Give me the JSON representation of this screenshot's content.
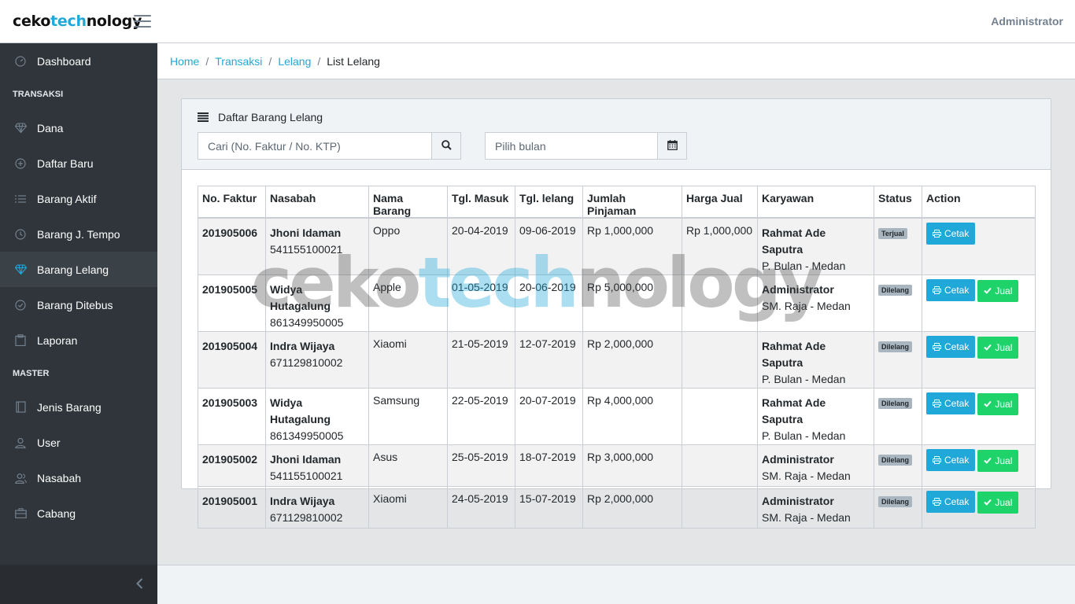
{
  "brand": {
    "part1": "ceko",
    "part2": "tech",
    "part3": "nology"
  },
  "header": {
    "user": "Administrator"
  },
  "sidebar": {
    "items": [
      {
        "label": "Dashboard",
        "icon": "speedometer-icon"
      },
      {
        "section": "TRANSAKSI"
      },
      {
        "label": "Dana",
        "icon": "diamond-icon"
      },
      {
        "label": "Daftar Baru",
        "icon": "plus-circle-icon"
      },
      {
        "label": "Barang Aktif",
        "icon": "list-icon"
      },
      {
        "label": "Barang J. Tempo",
        "icon": "clock-icon"
      },
      {
        "label": "Barang Lelang",
        "icon": "diamond-icon",
        "active": true
      },
      {
        "label": "Barang Ditebus",
        "icon": "check-circle-icon"
      },
      {
        "label": "Laporan",
        "icon": "clipboard-icon"
      },
      {
        "section": "MASTER"
      },
      {
        "label": "Jenis Barang",
        "icon": "book-icon"
      },
      {
        "label": "User",
        "icon": "user-icon"
      },
      {
        "label": "Nasabah",
        "icon": "users-icon"
      },
      {
        "label": "Cabang",
        "icon": "briefcase-icon"
      }
    ]
  },
  "breadcrumb": {
    "home": "Home",
    "transaksi": "Transaksi",
    "lelang": "Lelang",
    "current": "List Lelang",
    "sep": "/"
  },
  "card": {
    "title": "Daftar Barang Lelang",
    "search_placeholder": "Cari (No. Faktur / No. KTP)",
    "month_placeholder": "Pilih bulan"
  },
  "table": {
    "headers": [
      "No. Faktur",
      "Nasabah",
      "Nama Barang",
      "Tgl. Masuk",
      "Tgl. lelang",
      "Jumlah Pinjaman",
      "Harga Jual",
      "Karyawan",
      "Status",
      "Action"
    ],
    "rows": [
      {
        "faktur": "201905006",
        "nama": "Jhoni Idaman",
        "ktp": "541155100021",
        "barang": "Oppo",
        "masuk": "20-04-2019",
        "lelang": "09-06-2019",
        "pinjaman": "Rp 1,000,000",
        "harga": "Rp 1,000,000",
        "karyawan": "Rahmat Ade Saputra",
        "cabang": "P. Bulan - Medan",
        "status": "Terjual",
        "jual": false
      },
      {
        "faktur": "201905005",
        "nama": "Widya Hutagalung",
        "ktp": "861349950005",
        "barang": "Apple",
        "masuk": "01-05-2019",
        "lelang": "20-06-2019",
        "pinjaman": "Rp 5,000,000",
        "harga": "",
        "karyawan": "Administrator",
        "cabang": "SM. Raja - Medan",
        "status": "Dilelang",
        "jual": true
      },
      {
        "faktur": "201905004",
        "nama": "Indra Wijaya",
        "ktp": "671129810002",
        "barang": "Xiaomi",
        "masuk": "21-05-2019",
        "lelang": "12-07-2019",
        "pinjaman": "Rp 2,000,000",
        "harga": "",
        "karyawan": "Rahmat Ade Saputra",
        "cabang": "P. Bulan - Medan",
        "status": "Dilelang",
        "jual": true
      },
      {
        "faktur": "201905003",
        "nama": "Widya Hutagalung",
        "ktp": "861349950005",
        "barang": "Samsung",
        "masuk": "22-05-2019",
        "lelang": "20-07-2019",
        "pinjaman": "Rp 4,000,000",
        "harga": "",
        "karyawan": "Rahmat Ade Saputra",
        "cabang": "P. Bulan - Medan",
        "status": "Dilelang",
        "jual": true
      },
      {
        "faktur": "201905002",
        "nama": "Jhoni Idaman",
        "ktp": "541155100021",
        "barang": "Asus",
        "masuk": "25-05-2019",
        "lelang": "18-07-2019",
        "pinjaman": "Rp 3,000,000",
        "harga": "",
        "karyawan": "Administrator",
        "cabang": "SM. Raja - Medan",
        "status": "Dilelang",
        "jual": true
      },
      {
        "faktur": "201905001",
        "nama": "Indra Wijaya",
        "ktp": "671129810002",
        "barang": "Xiaomi",
        "masuk": "24-05-2019",
        "lelang": "15-07-2019",
        "pinjaman": "Rp 2,000,000",
        "harga": "",
        "karyawan": "Administrator",
        "cabang": "SM. Raja - Medan",
        "status": "Dilelang",
        "jual": true
      }
    ],
    "cetak_label": "Cetak",
    "jual_label": "Jual"
  },
  "colors": {
    "primary": "#20a8d8",
    "success": "#1fd36b",
    "sidebar": "#2f353a"
  }
}
